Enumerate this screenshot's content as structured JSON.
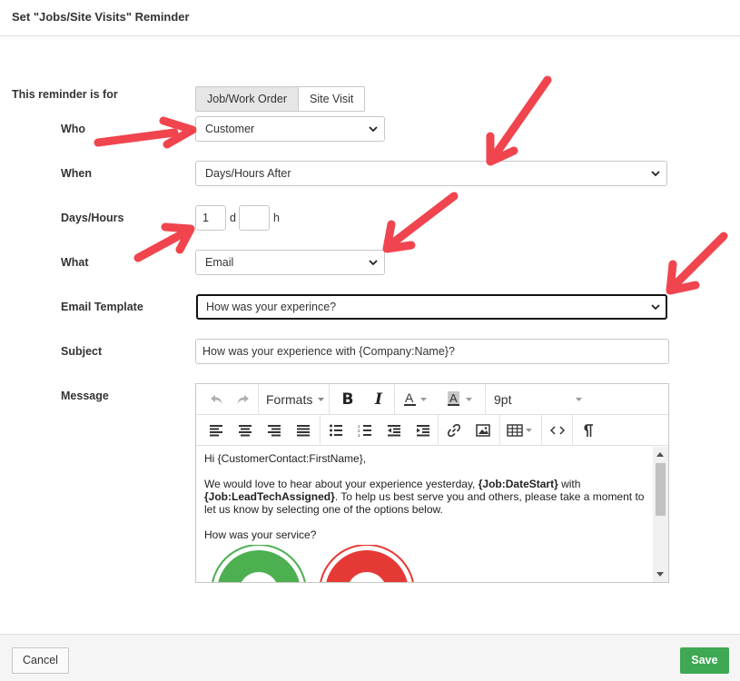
{
  "dialog": {
    "title": "Set \"Jobs/Site Visits\" Reminder"
  },
  "form": {
    "reminder_for_label": "This reminder is for",
    "reminder_for_options": [
      "Job/Work Order",
      "Site Visit"
    ],
    "reminder_for_selected": "Job/Work Order",
    "who": {
      "label": "Who",
      "value": "Customer"
    },
    "when": {
      "label": "When",
      "value": "Days/Hours After"
    },
    "days_hours": {
      "label": "Days/Hours",
      "days_value": "1",
      "days_unit": "d",
      "hours_value": "",
      "hours_unit": "h"
    },
    "what": {
      "label": "What",
      "value": "Email"
    },
    "email_template": {
      "label": "Email Template",
      "value": "How was your experince?"
    },
    "subject": {
      "label": "Subject",
      "value": "How was your experience with {Company:Name}?"
    },
    "message": {
      "label": "Message",
      "toolbar": {
        "undo_icon": "undo-icon",
        "redo_icon": "redo-icon",
        "formats_label": "Formats",
        "font_size": "9pt"
      },
      "content": {
        "greeting": "Hi {CustomerContact:FirstName},",
        "p1_a": "We would love to hear about your experience yesterday, ",
        "p1_b": "{Job:DateStart}",
        "p1_c": " with ",
        "p1_d": "{Job:LeadTechAssigned}",
        "p1_e": ". To help us best serve you and others, please take a moment to let us know by selecting one of the options below.",
        "question": "How was your service?"
      },
      "rating_colors": {
        "good": "#4caf50",
        "bad": "#e53935"
      }
    }
  },
  "footer": {
    "cancel_label": "Cancel",
    "save_label": "Save"
  },
  "colors": {
    "save_button": "#3ea853",
    "annotation_arrow": "#f0454e"
  }
}
